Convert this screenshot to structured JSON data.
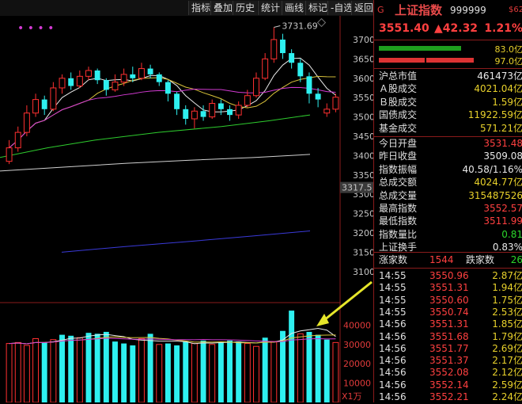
{
  "toolbar": {
    "buttons": [
      "指标",
      "叠加",
      "历史",
      "统计",
      "画线",
      "标记",
      "-自选",
      "返回"
    ]
  },
  "chart": {
    "markers": "• • • •",
    "price_labels": [
      "3700",
      "3650",
      "3600",
      "3550",
      "3500",
      "3450",
      "3400",
      "3350",
      "3300",
      "3250",
      "3200",
      "3150",
      "3100"
    ],
    "current_price_tag": "3317.5",
    "peak_label": "3731.69",
    "volume_labels": [
      "40000",
      "30000",
      "20000",
      "10000"
    ],
    "volume_unit": "X1万",
    "colors": {
      "up": "#ff3030",
      "down": "#2ef0f0",
      "ma5": "#e8e8e8",
      "ma10": "#d9c23a",
      "ma20": "#d23ad2",
      "ma60": "#2ecc2e",
      "ma120": "#cfcfcf",
      "ma250": "#3a3ad9",
      "arrow": "#e6e62a"
    },
    "candles": [
      {
        "o": 3385,
        "c": 3420,
        "h": 3440,
        "l": 3378
      },
      {
        "o": 3420,
        "c": 3460,
        "h": 3475,
        "l": 3410
      },
      {
        "o": 3460,
        "c": 3510,
        "h": 3530,
        "l": 3450
      },
      {
        "o": 3510,
        "c": 3545,
        "h": 3560,
        "l": 3500
      },
      {
        "o": 3545,
        "c": 3520,
        "h": 3555,
        "l": 3505
      },
      {
        "o": 3520,
        "c": 3575,
        "h": 3590,
        "l": 3515
      },
      {
        "o": 3575,
        "c": 3600,
        "h": 3610,
        "l": 3560
      },
      {
        "o": 3600,
        "c": 3580,
        "h": 3615,
        "l": 3570
      },
      {
        "o": 3580,
        "c": 3605,
        "h": 3620,
        "l": 3575
      },
      {
        "o": 3605,
        "c": 3620,
        "h": 3630,
        "l": 3595
      },
      {
        "o": 3620,
        "c": 3595,
        "h": 3625,
        "l": 3585
      },
      {
        "o": 3595,
        "c": 3570,
        "h": 3600,
        "l": 3555
      },
      {
        "o": 3570,
        "c": 3590,
        "h": 3610,
        "l": 3565
      },
      {
        "o": 3590,
        "c": 3610,
        "h": 3625,
        "l": 3580
      },
      {
        "o": 3610,
        "c": 3600,
        "h": 3630,
        "l": 3590
      },
      {
        "o": 3600,
        "c": 3625,
        "h": 3640,
        "l": 3595
      },
      {
        "o": 3625,
        "c": 3610,
        "h": 3635,
        "l": 3600
      },
      {
        "o": 3610,
        "c": 3590,
        "h": 3615,
        "l": 3580
      },
      {
        "o": 3590,
        "c": 3560,
        "h": 3595,
        "l": 3540
      },
      {
        "o": 3560,
        "c": 3520,
        "h": 3565,
        "l": 3505
      },
      {
        "o": 3520,
        "c": 3495,
        "h": 3530,
        "l": 3480
      },
      {
        "o": 3495,
        "c": 3515,
        "h": 3525,
        "l": 3470
      },
      {
        "o": 3515,
        "c": 3500,
        "h": 3530,
        "l": 3490
      },
      {
        "o": 3500,
        "c": 3535,
        "h": 3545,
        "l": 3495
      },
      {
        "o": 3535,
        "c": 3520,
        "h": 3545,
        "l": 3505
      },
      {
        "o": 3520,
        "c": 3505,
        "h": 3530,
        "l": 3490
      },
      {
        "o": 3505,
        "c": 3530,
        "h": 3540,
        "l": 3495
      },
      {
        "o": 3530,
        "c": 3555,
        "h": 3570,
        "l": 3525
      },
      {
        "o": 3555,
        "c": 3600,
        "h": 3615,
        "l": 3550
      },
      {
        "o": 3600,
        "c": 3650,
        "h": 3665,
        "l": 3595
      },
      {
        "o": 3650,
        "c": 3700,
        "h": 3731.69,
        "l": 3640
      },
      {
        "o": 3700,
        "c": 3665,
        "h": 3715,
        "l": 3650
      },
      {
        "o": 3665,
        "c": 3640,
        "h": 3675,
        "l": 3625
      },
      {
        "o": 3640,
        "c": 3605,
        "h": 3650,
        "l": 3590
      },
      {
        "o": 3605,
        "c": 3560,
        "h": 3615,
        "l": 3535
      },
      {
        "o": 3560,
        "c": 3545,
        "h": 3575,
        "l": 3525
      },
      {
        "o": 3510,
        "c": 3520,
        "h": 3535,
        "l": 3500
      },
      {
        "o": 3520,
        "c": 3551,
        "h": 3560,
        "l": 3512
      }
    ],
    "volumes": [
      {
        "v": 30500,
        "up": true
      },
      {
        "v": 31000,
        "up": true
      },
      {
        "v": 29500,
        "up": true
      },
      {
        "v": 33000,
        "up": true
      },
      {
        "v": 31000,
        "up": false
      },
      {
        "v": 32500,
        "up": true
      },
      {
        "v": 35000,
        "up": false
      },
      {
        "v": 34500,
        "up": false
      },
      {
        "v": 33500,
        "up": true
      },
      {
        "v": 36000,
        "up": false
      },
      {
        "v": 35500,
        "up": false
      },
      {
        "v": 36500,
        "up": false
      },
      {
        "v": 31500,
        "up": false
      },
      {
        "v": 30500,
        "up": false
      },
      {
        "v": 29500,
        "up": false
      },
      {
        "v": 33000,
        "up": true
      },
      {
        "v": 35500,
        "up": false
      },
      {
        "v": 30000,
        "up": true
      },
      {
        "v": 30500,
        "up": false
      },
      {
        "v": 29500,
        "up": false
      },
      {
        "v": 31500,
        "up": false
      },
      {
        "v": 30500,
        "up": true
      },
      {
        "v": 32000,
        "up": false
      },
      {
        "v": 30000,
        "up": true
      },
      {
        "v": 31000,
        "up": false
      },
      {
        "v": 32000,
        "up": false
      },
      {
        "v": 31500,
        "up": false
      },
      {
        "v": 30500,
        "up": true
      },
      {
        "v": 29000,
        "up": true
      },
      {
        "v": 33500,
        "up": false
      },
      {
        "v": 31500,
        "up": true
      },
      {
        "v": 37000,
        "up": false
      },
      {
        "v": 47500,
        "up": false
      },
      {
        "v": 35500,
        "up": true
      },
      {
        "v": 36500,
        "up": false
      },
      {
        "v": 35000,
        "up": false
      },
      {
        "v": 32500,
        "up": false
      },
      {
        "v": 31000,
        "up": true
      }
    ]
  },
  "header": {
    "badge": "G",
    "index_name": "上证指数",
    "code": "999999",
    "corner": "$62",
    "price": "3551.40",
    "change": "▲42.32",
    "change_pct": "1.21%",
    "bar1_value": "83.0亿",
    "bar2_value": "97.0亿"
  },
  "stats1": [
    {
      "label": "沪总市值",
      "value": "461473亿",
      "cls": "white"
    },
    {
      "label": "Ａ股成交",
      "value": "4021.04亿",
      "cls": "yellow"
    },
    {
      "label": "Ｂ股成交",
      "value": "1.59亿",
      "cls": "yellow"
    },
    {
      "label": "国债成交",
      "value": "11922.59亿",
      "cls": "yellow"
    },
    {
      "label": "基金成交",
      "value": "571.21亿",
      "cls": "yellow"
    }
  ],
  "stats2": [
    {
      "label": "今日开盘",
      "value": "3531.48",
      "cls": "red"
    },
    {
      "label": "昨日收盘",
      "value": "3509.08",
      "cls": "white"
    },
    {
      "label": "指数振幅",
      "value": "40.58/1.16%",
      "cls": "white"
    },
    {
      "label": "总成交额",
      "value": "4024.77亿",
      "cls": "yellow"
    },
    {
      "label": "总成交量",
      "value": "315487526",
      "cls": "yellow"
    },
    {
      "label": "最高指数",
      "value": "3552.57",
      "cls": "red"
    },
    {
      "label": "最低指数",
      "value": "3511.99",
      "cls": "red"
    },
    {
      "label": "指数量比",
      "value": "0.81",
      "cls": "green"
    },
    {
      "label": "上证换手",
      "value": "0.83%",
      "cls": "white"
    }
  ],
  "breadth": {
    "up_label": "涨家数",
    "up_value": "1544",
    "down_label": "跌家数",
    "down_value": "26"
  },
  "ticks": [
    {
      "time": "14:55",
      "price": "3550.96",
      "vol": "2.87亿"
    },
    {
      "time": "14:55",
      "price": "3551.31",
      "vol": "1.94亿"
    },
    {
      "time": "14:55",
      "price": "3550.60",
      "vol": "1.75亿"
    },
    {
      "time": "14:55",
      "price": "3550.74",
      "vol": "2.53亿"
    },
    {
      "time": "14:56",
      "price": "3551.31",
      "vol": "1.85亿"
    },
    {
      "time": "14:56",
      "price": "3551.68",
      "vol": "1.79亿"
    },
    {
      "time": "14:56",
      "price": "3551.77",
      "vol": "2.69亿"
    },
    {
      "time": "14:56",
      "price": "3551.37",
      "vol": "2.17亿"
    },
    {
      "time": "14:56",
      "price": "3552.08",
      "vol": "2.12亿"
    },
    {
      "time": "14:56",
      "price": "3552.14",
      "vol": "2.59亿"
    },
    {
      "time": "14:56",
      "price": "3552.21",
      "vol": "2.24亿"
    }
  ]
}
